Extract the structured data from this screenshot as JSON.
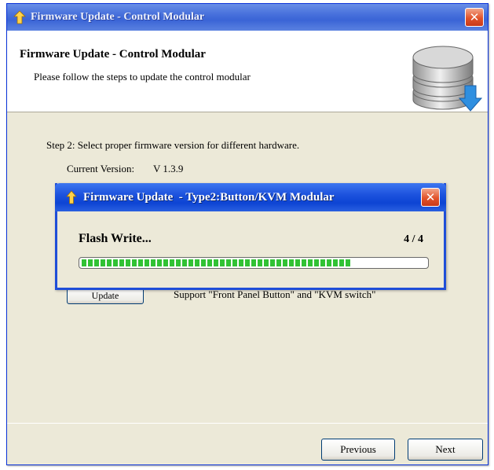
{
  "window": {
    "title": "Firmware Update - Control Modular",
    "close_label": "✕"
  },
  "header": {
    "title": "Firmware Update - Control Modular",
    "subtitle": "Please follow the steps to update the control modular",
    "icon": "database-download-icon"
  },
  "content": {
    "step_text": "Step 2: Select proper firmware version for different hardware.",
    "current_version_label": "Current Version:",
    "current_version_value": "V 1.3.9",
    "update_button_label": "Update",
    "support_text": "Support \"Front Panel Button\" and \"KVM switch\""
  },
  "footer": {
    "previous_label": "Previous",
    "next_label": "Next"
  },
  "modal": {
    "title": "Firmware Update  - Type2:Button/KVM Modular",
    "close_label": "✕",
    "status_text": "Flash Write...",
    "progress_count": "4 / 4",
    "progress_fraction": 0.78
  },
  "colors": {
    "window_bg": "#ece9d8",
    "titlebar": "#3a64d6",
    "progress_green": "#31c234",
    "close_red": "#e2532a"
  }
}
